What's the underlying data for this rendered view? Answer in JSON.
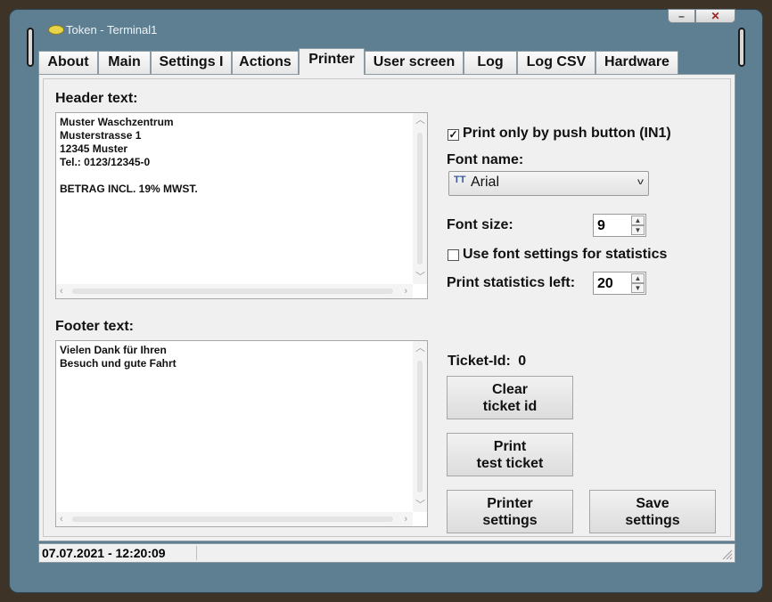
{
  "window": {
    "title": "Token - Terminal1",
    "minimize_label": "–",
    "close_label": "✕"
  },
  "tabs": [
    "About",
    "Main",
    "Settings I",
    "Actions",
    "Printer",
    "User screen",
    "Log",
    "Log CSV",
    "Hardware"
  ],
  "active_tab": "Printer",
  "header": {
    "label": "Header text:",
    "lines": [
      "Muster Waschzentrum",
      "Musterstrasse 1",
      "12345 Muster",
      "Tel.: 0123/12345-0",
      "",
      "BETRAG INCL. 19% MWST."
    ]
  },
  "footer": {
    "label": "Footer text:",
    "lines": [
      "Vielen Dank für Ihren",
      "Besuch und gute Fahrt"
    ]
  },
  "settings": {
    "push_button_label": "Print only by push button (IN1)",
    "push_button_checked": true,
    "check_mark": "✓",
    "font_name_label": "Font name:",
    "font_name_value": "Arial",
    "font_size_label": "Font size:",
    "font_size_value": "9",
    "use_font_stats_label": "Use font settings for statistics",
    "use_font_stats_checked": false,
    "print_stats_left_label": "Print statistics left:",
    "print_stats_left_value": "20"
  },
  "ticket": {
    "label": "Ticket-Id:",
    "value": "0"
  },
  "buttons": {
    "clear_ticket": [
      "Clear",
      "ticket id"
    ],
    "print_test": [
      "Print",
      "test ticket"
    ],
    "printer_settings": [
      "Printer",
      "settings"
    ],
    "save_settings": [
      "Save",
      "settings"
    ]
  },
  "status": {
    "datetime": "07.07.2021 - 12:20:09"
  },
  "icons": {
    "title": "token-icon",
    "font": "truetype-font-icon",
    "dropdown": "chevron-down-icon"
  }
}
